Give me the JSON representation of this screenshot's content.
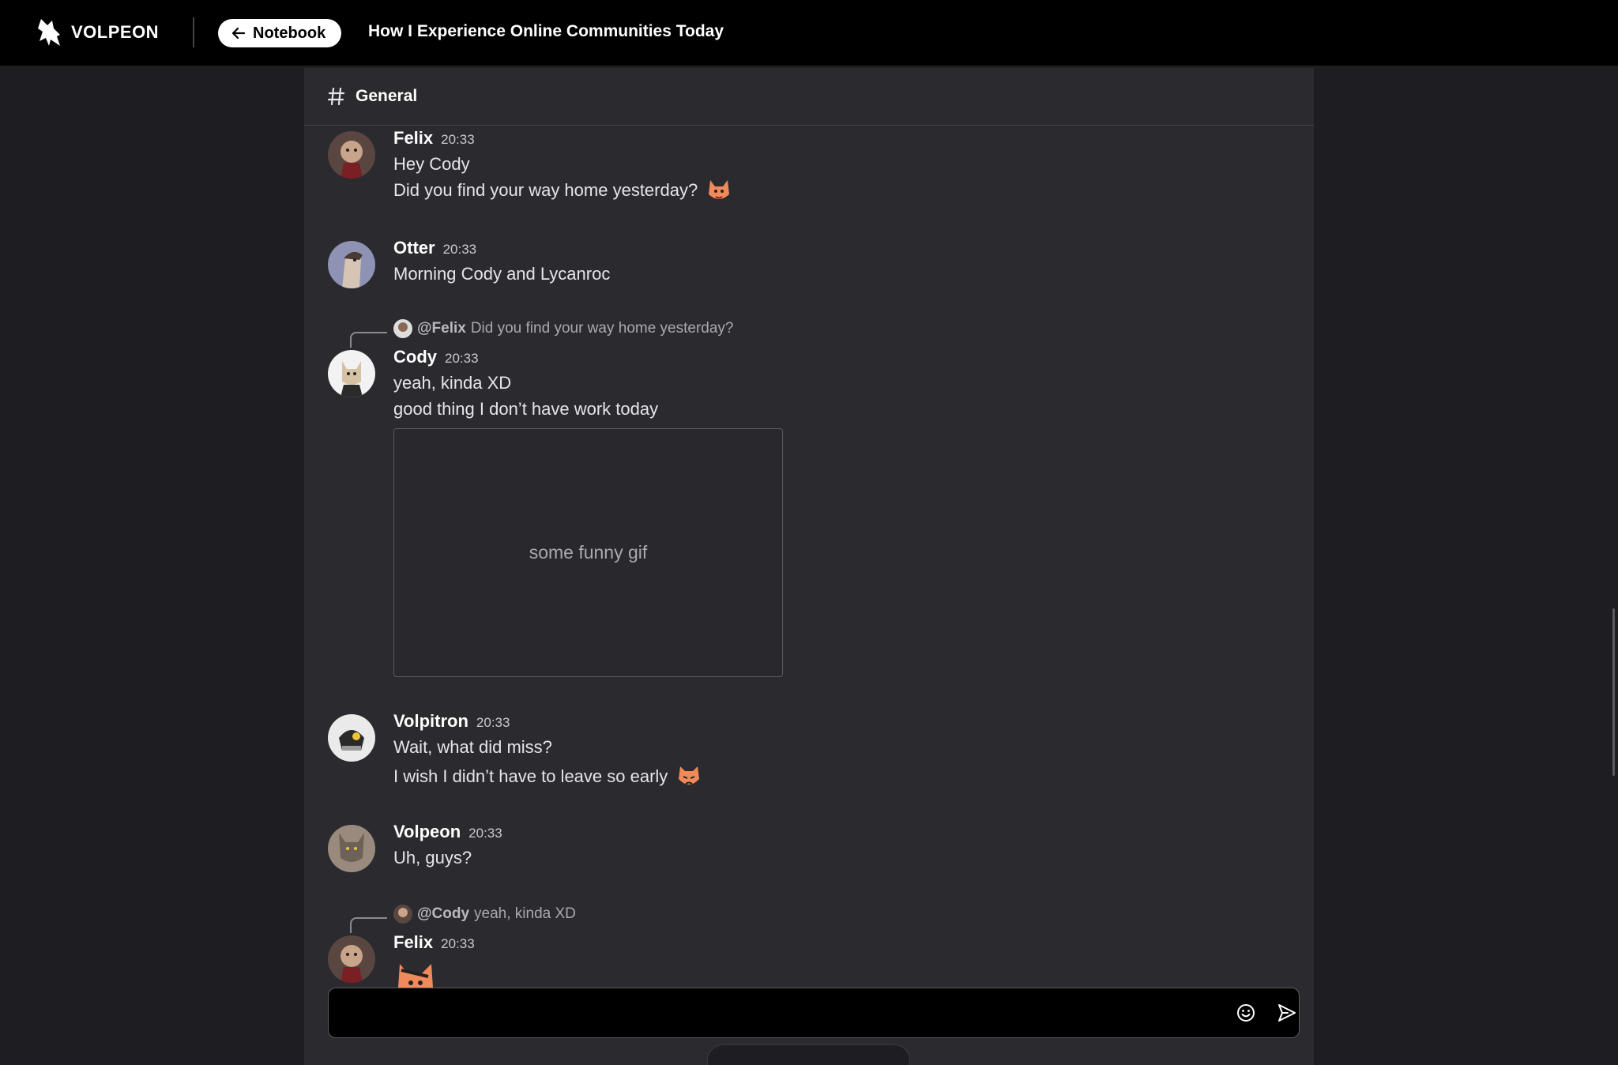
{
  "header": {
    "brand": "VOLPEON",
    "back_label": "Notebook",
    "title": "How I Experience Online Communities Today"
  },
  "channel": {
    "name": "General"
  },
  "messages": [
    {
      "author": "Felix",
      "time": "20:33",
      "lines": [
        "Hey Cody",
        "Did you find your way home yesterday?"
      ]
    },
    {
      "author": "Otter",
      "time": "20:33",
      "lines": [
        "Morning Cody and Lycanroc"
      ]
    },
    {
      "reply_mention": "@Felix",
      "reply_text": "Did you find your way home yesterday?",
      "author": "Cody",
      "time": "20:33",
      "lines": [
        "yeah, kinda XD",
        "good thing I don’t have work today"
      ],
      "attachment": "some funny gif"
    },
    {
      "author": "Volpitron",
      "time": "20:33",
      "lines": [
        "Wait, what did miss?",
        "I wish I didn’t have to leave so early"
      ]
    },
    {
      "author": "Volpeon",
      "time": "20:33",
      "lines": [
        "Uh, guys?"
      ]
    },
    {
      "reply_mention": "@Cody",
      "reply_text": "yeah, kinda XD",
      "author": "Felix",
      "time": "20:33",
      "lines": []
    }
  ],
  "composer": {
    "placeholder": ""
  },
  "icons": [
    "volpeon-logo-icon",
    "arrow-left-icon",
    "hash-icon",
    "emoji-icon",
    "send-icon"
  ],
  "colors": {
    "topbar": "#000000",
    "panel": "#2a2a2f",
    "background": "#1e1e22"
  }
}
